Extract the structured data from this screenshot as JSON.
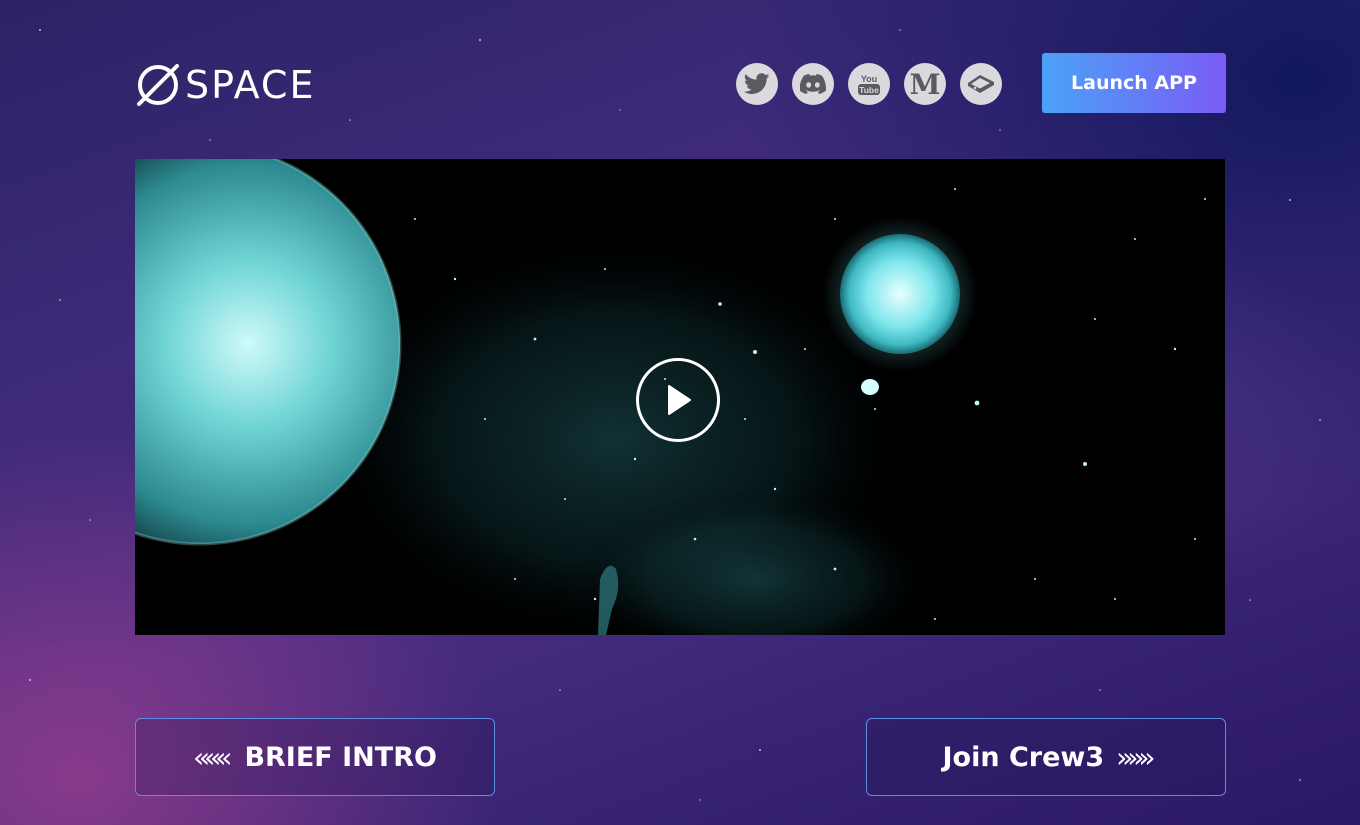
{
  "header": {
    "logo_text": "SPACE",
    "social": [
      {
        "icon": "twitter-icon"
      },
      {
        "icon": "discord-icon"
      },
      {
        "icon": "youtube-icon"
      },
      {
        "icon": "medium-icon"
      },
      {
        "icon": "gitbook-icon"
      }
    ],
    "launch_label": "Launch APP",
    "launch_gradient": [
      "#4aa2f7",
      "#7a5cf5"
    ]
  },
  "video": {
    "play_icon": "play-icon"
  },
  "nav": {
    "intro_chevron": "«««",
    "intro_label": "BRIEF INTRO",
    "crew_label": "Join Crew3",
    "crew_chevron": "»»»"
  },
  "colors": {
    "accent_border": "#5a8de6",
    "planet": "#5fc7c8"
  }
}
